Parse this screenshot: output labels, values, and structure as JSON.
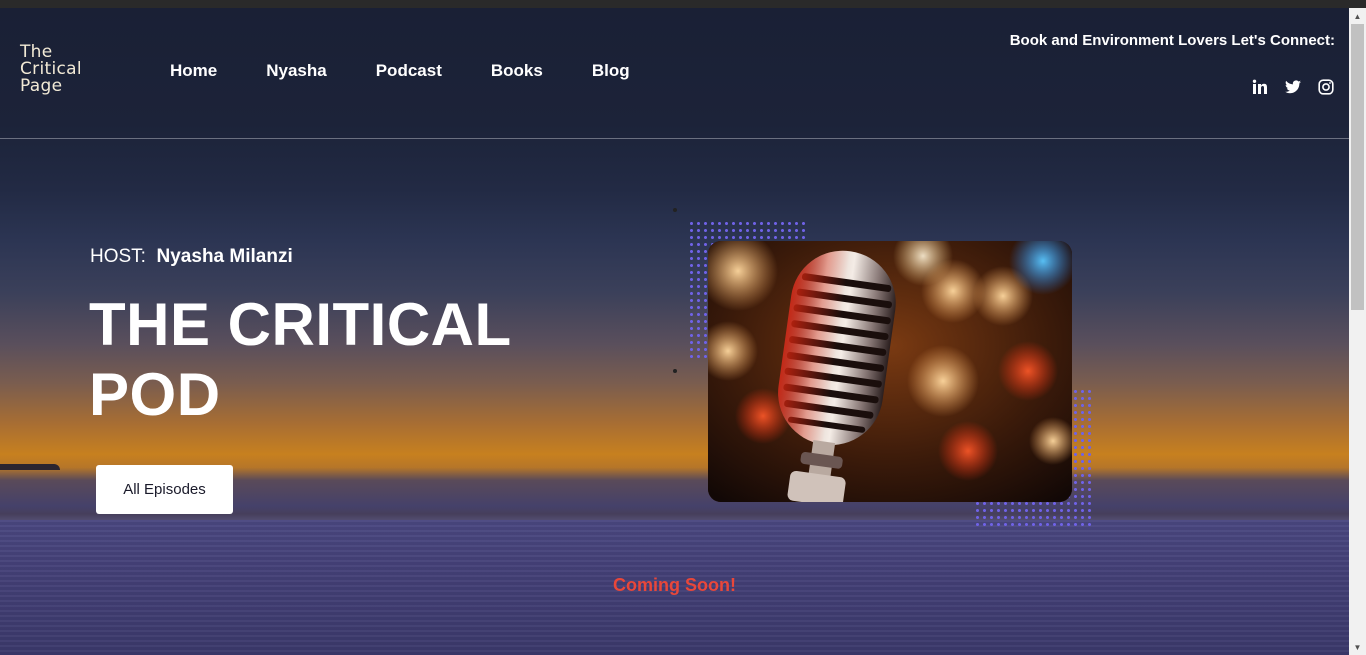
{
  "logo": {
    "line1": "The",
    "line2": "Critical",
    "line3": "Page"
  },
  "nav": [
    {
      "label": "Home"
    },
    {
      "label": "Nyasha"
    },
    {
      "label": "Podcast"
    },
    {
      "label": "Books"
    },
    {
      "label": "Blog"
    }
  ],
  "connect": {
    "text": "Book and Environment Lovers Let's Connect:"
  },
  "socials": [
    {
      "icon": "linkedin-icon"
    },
    {
      "icon": "twitter-icon"
    },
    {
      "icon": "instagram-icon"
    }
  ],
  "hero": {
    "host_label": "HOST:",
    "host_name": "Nyasha Milanzi",
    "title": "THE CRITICAL POD",
    "button": "All Episodes"
  },
  "footer_note": {
    "text": "Coming Soon!"
  },
  "colors": {
    "accent_dots": "#6f62e6",
    "coming_soon": "#e8473a"
  }
}
